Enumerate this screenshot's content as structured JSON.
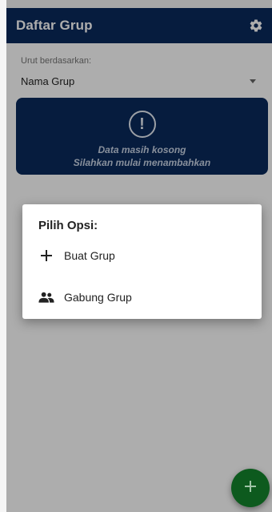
{
  "appbar": {
    "title": "Daftar Grup",
    "settings_icon": "gear-icon"
  },
  "sort": {
    "label": "Urut berdasarkan:",
    "selected": "Nama Grup"
  },
  "empty_state": {
    "icon": "alert-circle-icon",
    "line1": "Data masih kosong",
    "line2": "Silahkan mulai menambahkan"
  },
  "dialog": {
    "title": "Pilih Opsi:",
    "options": [
      {
        "label": "Buat Grup",
        "icon": "plus-icon"
      },
      {
        "label": "Gabung Grup",
        "icon": "group-icon"
      }
    ]
  },
  "fab": {
    "icon": "plus-icon"
  },
  "colors": {
    "primary": "#0a2a5c",
    "fab": "#0d5a1e"
  }
}
